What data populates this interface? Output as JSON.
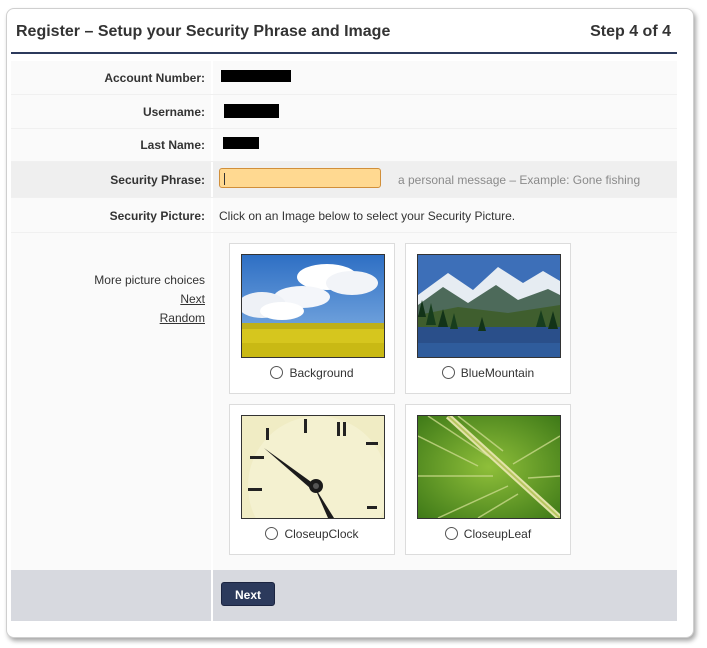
{
  "header": {
    "title": "Register – Setup your Security Phrase and Image",
    "step": "Step 4 of 4"
  },
  "fields": {
    "account_label": "Account Number:",
    "username_label": "Username:",
    "lastname_label": "Last Name:",
    "phrase_label": "Security Phrase:",
    "phrase_value": "",
    "phrase_hint": "a personal message – Example: Gone fishing",
    "picture_label": "Security Picture:",
    "picture_instructions": "Click on an Image below to select your Security Picture."
  },
  "more": {
    "label": "More picture choices",
    "next_link": "Next",
    "random_link": "Random"
  },
  "pictures": [
    {
      "name": "Background",
      "icon": "field-clouds-image",
      "selected": false
    },
    {
      "name": "BlueMountain",
      "icon": "mountain-lake-image",
      "selected": false
    },
    {
      "name": "CloseupClock",
      "icon": "clock-face-image",
      "selected": false
    },
    {
      "name": "CloseupLeaf",
      "icon": "green-leaf-image",
      "selected": false
    }
  ],
  "footer": {
    "next_button": "Next"
  },
  "colors": {
    "accent": "#2c3a5c",
    "input_bg": "#ffd991",
    "footer_bg": "#d7d9df"
  }
}
